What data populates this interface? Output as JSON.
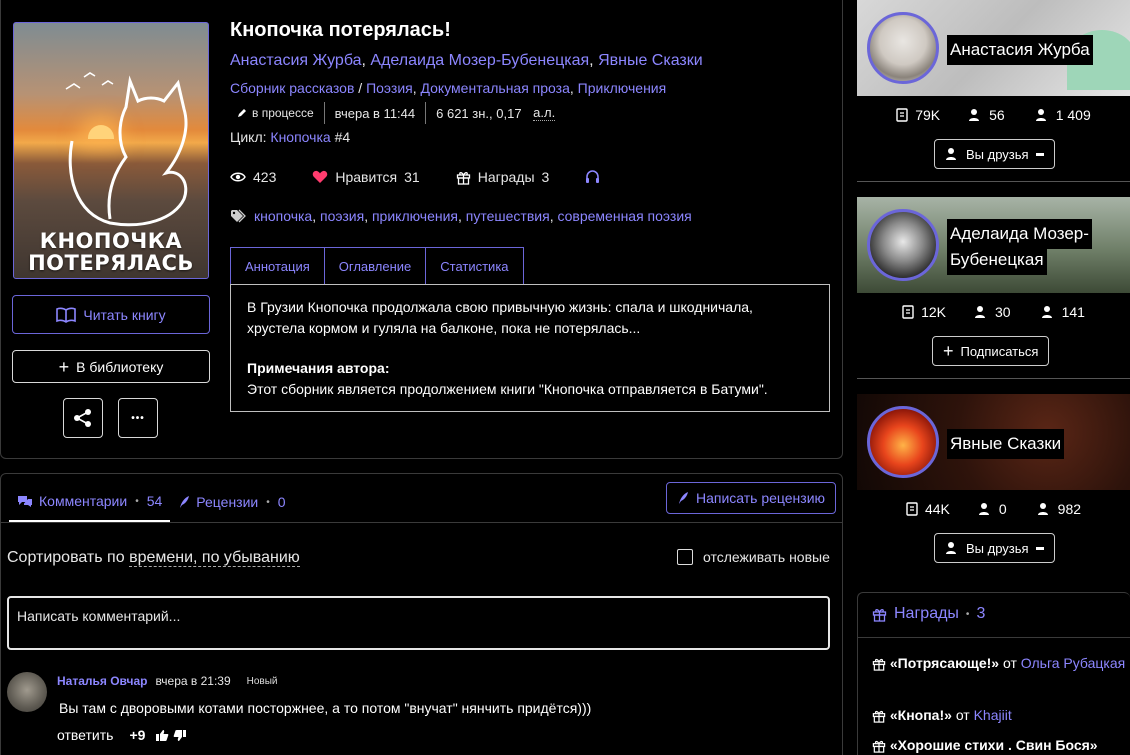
{
  "book": {
    "title": "Кнопочка потерялась!",
    "cover_title_line1": "КНОПОЧКА",
    "cover_title_line2": "ПОТЕРЯЛАСЬ",
    "authors": [
      "Анастасия Журба",
      "Аделаида Мозер-Бубенецкая",
      "Явные Сказки"
    ],
    "genre_primary": "Сборник рассказов",
    "genres": [
      "Поэзия",
      "Документальная проза",
      "Приключения"
    ],
    "status": "в процессе",
    "updated": "вчера в 11:44",
    "size_chars": "6 621 зн., 0,17",
    "size_unit": "а.л.",
    "cycle_label": "Цикл:",
    "cycle_name": "Кнопочка",
    "cycle_number": "#4",
    "views": "423",
    "likes_label": "Нравится",
    "likes": "31",
    "awards_label": "Награды",
    "awards_count": "3",
    "tags": [
      "кнопочка",
      "поэзия",
      "приключения",
      "путешествия",
      "современная поэзия"
    ]
  },
  "actions": {
    "read": "Читать книгу",
    "library": "В библиотеку",
    "more": "•••"
  },
  "tabs": [
    "Аннотация",
    "Оглавление",
    "Статистика"
  ],
  "annotation": {
    "line1": "В Грузии Кнопочка продолжала свою привычную жизнь: спала и шкодничала,",
    "line2": "хрустела кормом и гуляла на балконе, пока не потерялась...",
    "notes_heading": "Примечания автора:",
    "notes_text": "Этот сборник является продолжением книги \"Кнопочка отправляется в Батуми\"."
  },
  "comments_section": {
    "tab_comments": "Комментарии",
    "comments_count": "54",
    "tab_reviews": "Рецензии",
    "reviews_count": "0",
    "write_review": "Написать рецензию",
    "sort_prefix": "Сортировать по",
    "sort_by": "времени, по убыванию",
    "track_label": "отслеживать новые",
    "input_placeholder": "Написать комментарий..."
  },
  "comment": {
    "author": "Наталья Овчар",
    "time": "вчера в 21:39",
    "badge": "Новый",
    "text": "Вы там с дворовыми котами посторжнее, а то потом \"внучат\" нянчить придётся)))",
    "reply": "ответить",
    "score": "+9"
  },
  "author_cards": [
    {
      "name": "Анастасия Журба",
      "books": "79K",
      "subs": "56",
      "followers": "1 409",
      "button": "Вы друзья",
      "button_icon": "user-minus-icon"
    },
    {
      "name_line1": "Аделаида Мозер-",
      "name_line2": "Бубенецкая",
      "books": "12K",
      "subs": "30",
      "followers": "141",
      "button": "Подписаться",
      "button_icon": "plus-icon"
    },
    {
      "name": "Явные Сказки",
      "books": "44K",
      "subs": "0",
      "followers": "982",
      "button": "Вы друзья",
      "button_icon": "user-minus-icon"
    }
  ],
  "awards_panel": {
    "title": "Награды",
    "count": "3",
    "items": [
      {
        "name": "«Потрясающе!»",
        "from": "от",
        "giver": "Ольга Рубацкая"
      },
      {
        "name": "«Кнопа!»",
        "from": "от",
        "giver": "Khajiit"
      },
      {
        "name": "«Хорошие стихи . Свин Бося»",
        "from": "",
        "giver": ""
      }
    ]
  },
  "colors": {
    "accent": "#8c86ff",
    "background": "#000000",
    "like": "#ff3c6e"
  }
}
